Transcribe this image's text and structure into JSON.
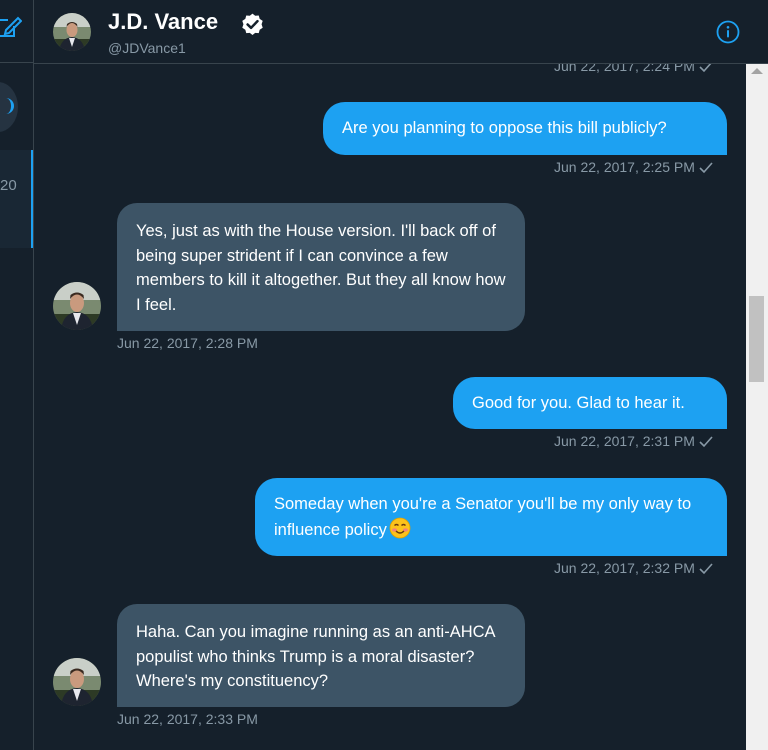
{
  "sidebar": {
    "conversation_snippet": "20"
  },
  "header": {
    "name": "J.D. Vance",
    "handle": "@JDVance1"
  },
  "messages": [
    {
      "direction": "out",
      "timestamp": "Jun 22, 2017, 2:24 PM"
    },
    {
      "direction": "out",
      "text": "Are you planning to oppose this bill publicly?",
      "timestamp": "Jun 22, 2017, 2:25 PM"
    },
    {
      "direction": "in",
      "text": "Yes, just as with the House version. I'll back off of being super strident if I can convince a few members to kill it altogether. But they all know how I feel.",
      "timestamp": "Jun 22, 2017, 2:28 PM"
    },
    {
      "direction": "out",
      "text": "Good for you. Glad to hear it.",
      "timestamp": "Jun 22, 2017, 2:31 PM"
    },
    {
      "direction": "out",
      "text": "Someday when you're a Senator you'll be my only way to influence policy",
      "emoji": "smiling-face-with-smiling-eyes-emoji",
      "timestamp": "Jun 22, 2017, 2:32 PM"
    },
    {
      "direction": "in",
      "text": "Haha. Can you imagine running as an anti-AHCA populist who thinks Trump is a moral disaster?  Where's my constituency?",
      "timestamp": "Jun 22, 2017, 2:33 PM"
    }
  ],
  "colors": {
    "background": "#15202b",
    "accent": "#1da1f2",
    "incoming_bubble": "#3d5466",
    "secondary_text": "#8899a6"
  },
  "icons": [
    "compose-icon",
    "verified-badge-icon",
    "info-icon",
    "read-check-icon",
    "scroll-up-arrow-icon"
  ]
}
